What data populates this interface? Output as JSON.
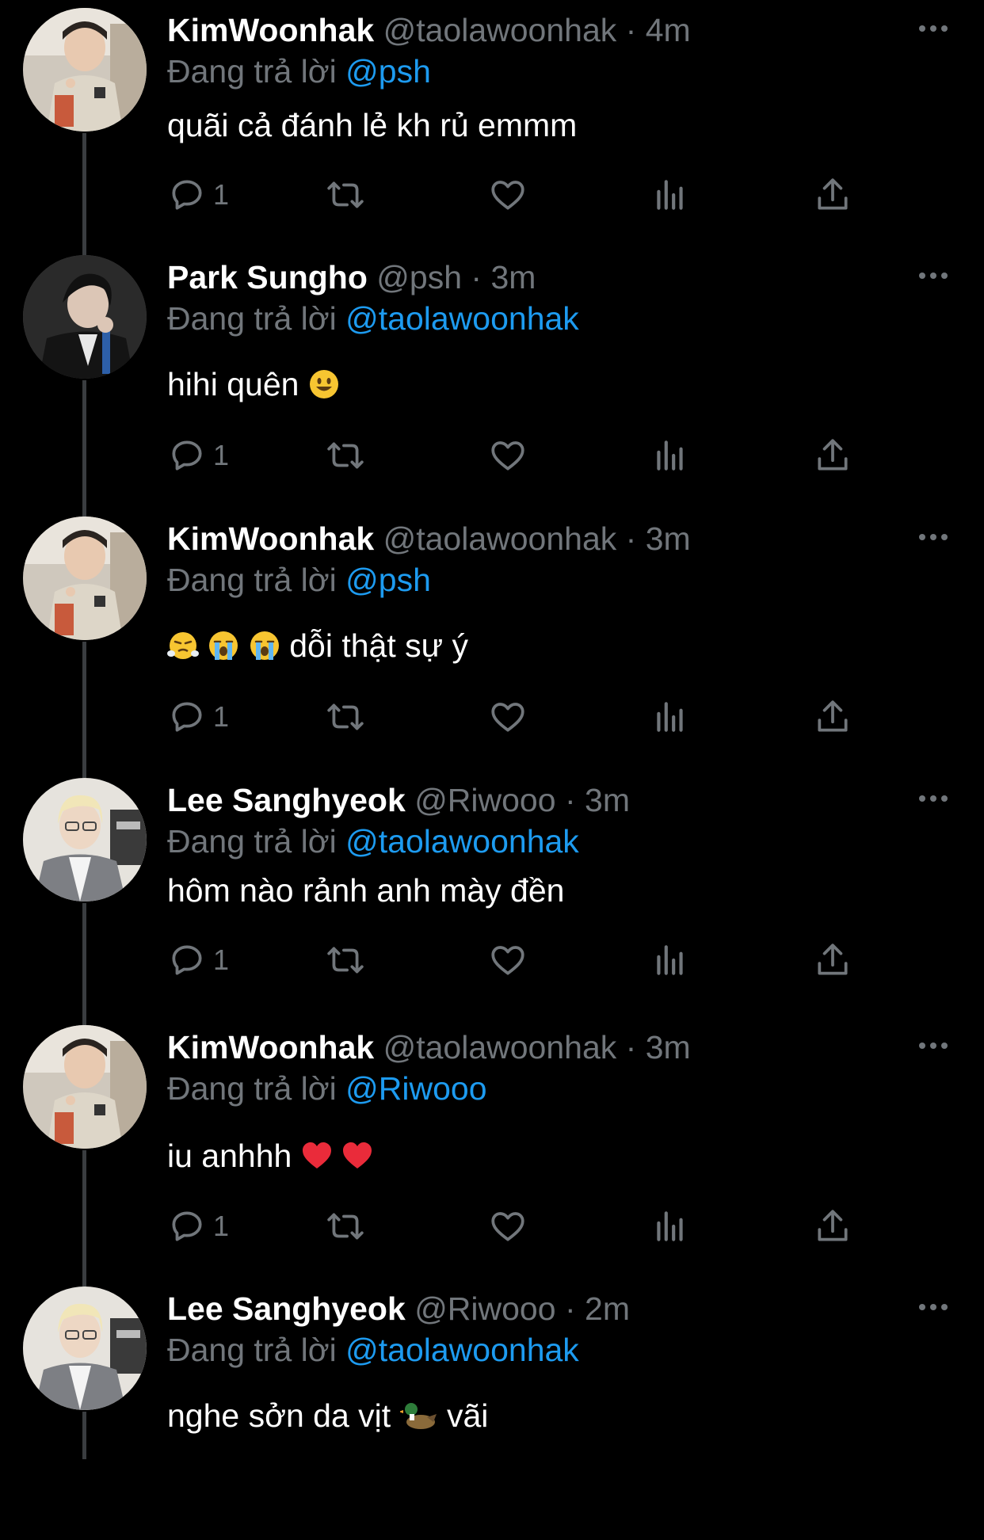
{
  "tweets": [
    {
      "author": "KimWoonhak",
      "handle": "@taolawoonhak",
      "separator": "·",
      "time": "4m",
      "replying_prefix": "Đang trả lời",
      "replying_to": "@psh",
      "text": "quãi cả đánh lẻ kh rủ emmm",
      "emoji": [],
      "reply_count": "1",
      "avatar_icon": "avatar-kimwoonhak"
    },
    {
      "author": "Park Sungho",
      "handle": "@psh",
      "separator": "·",
      "time": "3m",
      "replying_prefix": "Đang trả lời",
      "replying_to": "@taolawoonhak",
      "text": "hihi quên",
      "emoji": [
        "grinning-face"
      ],
      "reply_count": "1",
      "avatar_icon": "avatar-parksungho"
    },
    {
      "author": "KimWoonhak",
      "handle": "@taolawoonhak",
      "separator": "·",
      "time": "3m",
      "replying_prefix": "Đang trả lời",
      "replying_to": "@psh",
      "text": "dỗi thật sự ý",
      "emoji": [
        "face-with-steam",
        "loudly-crying-face",
        "loudly-crying-face"
      ],
      "reply_count": "1",
      "avatar_icon": "avatar-kimwoonhak"
    },
    {
      "author": "Lee Sanghyeok",
      "handle": "@Riwooo",
      "separator": "·",
      "time": "3m",
      "replying_prefix": "Đang trả lời",
      "replying_to": "@taolawoonhak",
      "text": "hôm nào rảnh anh mày đền",
      "emoji": [],
      "reply_count": "1",
      "avatar_icon": "avatar-leesanghyeok"
    },
    {
      "author": "KimWoonhak",
      "handle": "@taolawoonhak",
      "separator": "·",
      "time": "3m",
      "replying_prefix": "Đang trả lời",
      "replying_to": "@Riwooo",
      "text": "iu anhhh",
      "emoji": [
        "red-heart",
        "red-heart"
      ],
      "reply_count": "1",
      "avatar_icon": "avatar-kimwoonhak"
    },
    {
      "author": "Lee Sanghyeok",
      "handle": "@Riwooo",
      "separator": "·",
      "time": "2m",
      "replying_prefix": "Đang trả lời",
      "replying_to": "@taolawoonhak",
      "text_before": "nghe sởn da vịt",
      "text_after": "vãi",
      "emoji": [
        "duck"
      ],
      "avatar_icon": "avatar-leesanghyeok"
    }
  ],
  "colors": {
    "background": "#000000",
    "primary_text": "#ffffff",
    "secondary_text": "#71767b",
    "accent": "#1d9bf0",
    "thread_line": "#3a3d40"
  },
  "icons": {
    "reply": "reply-icon",
    "retweet": "retweet-icon",
    "like": "like-icon",
    "views": "views-icon",
    "share": "share-icon",
    "more": "more-icon"
  }
}
